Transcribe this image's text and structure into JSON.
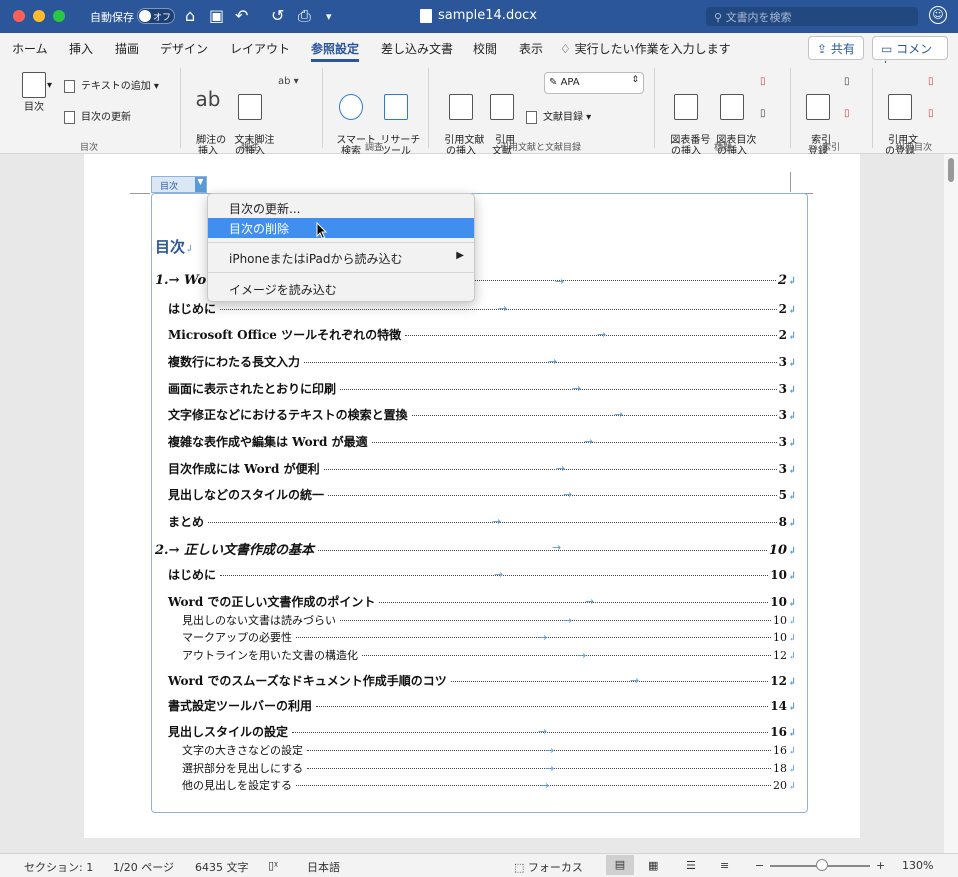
{
  "titlebar": {
    "autosave_label": "自動保存",
    "autosave_state": "オフ",
    "doc_title": "sample14.docx",
    "search_placeholder": "文書内を検索"
  },
  "tabs": [
    "ホーム",
    "挿入",
    "描画",
    "デザイン",
    "レイアウト",
    "参照設定",
    "差し込み文書",
    "校閲",
    "表示"
  ],
  "active_tab": "参照設定",
  "tell_me": "実行したい作業を入力します",
  "share_label": "共有",
  "comment_label": "コメント",
  "ribbon": {
    "toc": {
      "label": "目次",
      "add_text": "テキストの追加",
      "update": "目次の更新",
      "group": "目次"
    },
    "footnote": {
      "insert": "脚注の\n挿入",
      "endnote": "文末脚注\nの挿入",
      "group": "脚注"
    },
    "research": {
      "smart": "スマート\n検索",
      "tool": "リサーチ\nツール",
      "group": "調査"
    },
    "citation": {
      "insert": "引用文献\nの挿入",
      "biblio": "引用\n文献",
      "style": "APA",
      "bibliography": "文献目録",
      "group": "引用文献と文献目録"
    },
    "captions": {
      "insert": "図表番号\nの挿入",
      "table_of_figures": "図表目次\nの挿入",
      "group": "標題"
    },
    "index": {
      "mark": "索引\n登録",
      "group": "索引"
    },
    "authorities": {
      "mark": "引用文\nの登録",
      "group": "出典目次"
    }
  },
  "toc_control": {
    "tag": "目次"
  },
  "toc_heading": "目次",
  "context_menu": {
    "items": [
      "目次の更新...",
      "目次の削除",
      "iPhoneまたはiPadから読み込む",
      "イメージを読み込む"
    ],
    "selected_index": 1
  },
  "toc_entries": [
    {
      "level": 1,
      "text": "1.→ Wor",
      "page": "2"
    },
    {
      "level": 2,
      "text": "はじめに",
      "page": "2"
    },
    {
      "level": 2,
      "text": "Microsoft Office ツールそれぞれの特徴",
      "page": "2"
    },
    {
      "level": 2,
      "text": "複数行にわたる長文入力",
      "page": "3"
    },
    {
      "level": 2,
      "text": "画面に表示されたとおりに印刷",
      "page": "3"
    },
    {
      "level": 2,
      "text": "文字修正などにおけるテキストの検索と置換",
      "page": "3"
    },
    {
      "level": 2,
      "text": "複雑な表作成や編集は Word が最適",
      "page": "3"
    },
    {
      "level": 2,
      "text": "目次作成には Word が便利",
      "page": "3"
    },
    {
      "level": 2,
      "text": "見出しなどのスタイルの統一",
      "page": "5"
    },
    {
      "level": 2,
      "text": "まとめ",
      "page": "8"
    },
    {
      "level": 1,
      "text": "2.→ 正しい文書作成の基本",
      "page": "10"
    },
    {
      "level": 2,
      "text": "はじめに",
      "page": "10"
    },
    {
      "level": 2,
      "text": "Word での正しい文書作成のポイント",
      "page": "10"
    },
    {
      "level": 3,
      "text": "見出しのない文書は読みづらい",
      "page": "10"
    },
    {
      "level": 3,
      "text": "マークアップの必要性",
      "page": "10"
    },
    {
      "level": 3,
      "text": "アウトラインを用いた文書の構造化",
      "page": "12"
    },
    {
      "level": 2,
      "text": "Word でのスムーズなドキュメント作成手順のコツ",
      "page": "12"
    },
    {
      "level": 2,
      "text": "書式設定ツールバーの利用",
      "page": "14"
    },
    {
      "level": 2,
      "text": "見出しスタイルの設定",
      "page": "16"
    },
    {
      "level": 3,
      "text": "文字の大きさなどの設定",
      "page": "16"
    },
    {
      "level": 3,
      "text": "選択部分を見出しにする",
      "page": "18"
    },
    {
      "level": 3,
      "text": "他の見出しを設定する",
      "page": "20"
    }
  ],
  "statusbar": {
    "section": "セクション: 1",
    "page": "1/20 ページ",
    "words": "6435 文字",
    "language": "日本語",
    "focus": "フォーカス",
    "zoom": "130%"
  }
}
